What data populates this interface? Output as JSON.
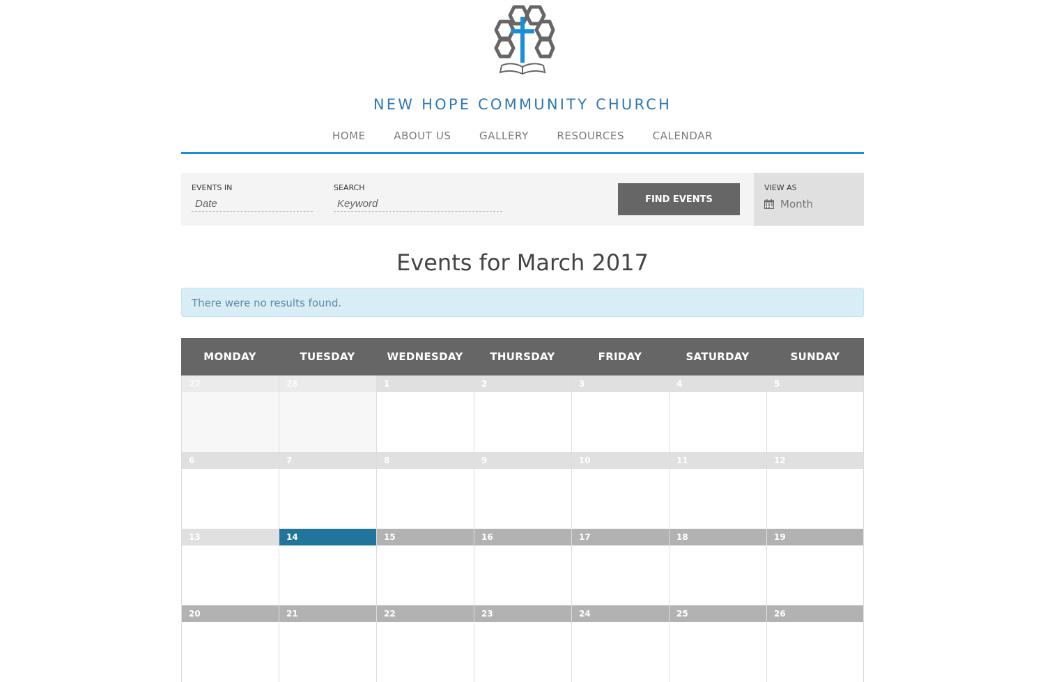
{
  "site": {
    "title": "NEW HOPE COMMUNITY CHURCH",
    "logo_icon": "church-logo-icon",
    "accent_color": "#1a8fd9"
  },
  "nav": {
    "items": [
      "HOME",
      "ABOUT US",
      "GALLERY",
      "RESOURCES",
      "CALENDAR"
    ]
  },
  "filter": {
    "events_in_label": "EVENTS IN",
    "date_placeholder": "Date",
    "search_label": "SEARCH",
    "keyword_placeholder": "Keyword",
    "find_button": "FIND EVENTS",
    "view_as_label": "VIEW AS",
    "view_as_value": "Month",
    "view_icon": "calendar-icon"
  },
  "main": {
    "title": "Events for March 2017",
    "notice": "There were no results found."
  },
  "calendar": {
    "weekdays": [
      "MONDAY",
      "TUESDAY",
      "WEDNESDAY",
      "THURSDAY",
      "FRIDAY",
      "SATURDAY",
      "SUNDAY"
    ],
    "today": "14",
    "today_color": "#21759b",
    "weeks": [
      [
        {
          "d": "27",
          "s": "other"
        },
        {
          "d": "28",
          "s": "other"
        },
        {
          "d": "1",
          "s": "past"
        },
        {
          "d": "2",
          "s": "past"
        },
        {
          "d": "3",
          "s": "past"
        },
        {
          "d": "4",
          "s": "past"
        },
        {
          "d": "5",
          "s": "past"
        }
      ],
      [
        {
          "d": "6",
          "s": "past"
        },
        {
          "d": "7",
          "s": "past"
        },
        {
          "d": "8",
          "s": "past"
        },
        {
          "d": "9",
          "s": "past"
        },
        {
          "d": "10",
          "s": "past"
        },
        {
          "d": "11",
          "s": "past"
        },
        {
          "d": "12",
          "s": "past"
        }
      ],
      [
        {
          "d": "13",
          "s": "past"
        },
        {
          "d": "14",
          "s": "today"
        },
        {
          "d": "15",
          "s": "future"
        },
        {
          "d": "16",
          "s": "future"
        },
        {
          "d": "17",
          "s": "future"
        },
        {
          "d": "18",
          "s": "future"
        },
        {
          "d": "19",
          "s": "future"
        }
      ],
      [
        {
          "d": "20",
          "s": "future"
        },
        {
          "d": "21",
          "s": "future"
        },
        {
          "d": "22",
          "s": "future"
        },
        {
          "d": "23",
          "s": "future"
        },
        {
          "d": "24",
          "s": "future"
        },
        {
          "d": "25",
          "s": "future"
        },
        {
          "d": "26",
          "s": "future"
        }
      ]
    ]
  }
}
